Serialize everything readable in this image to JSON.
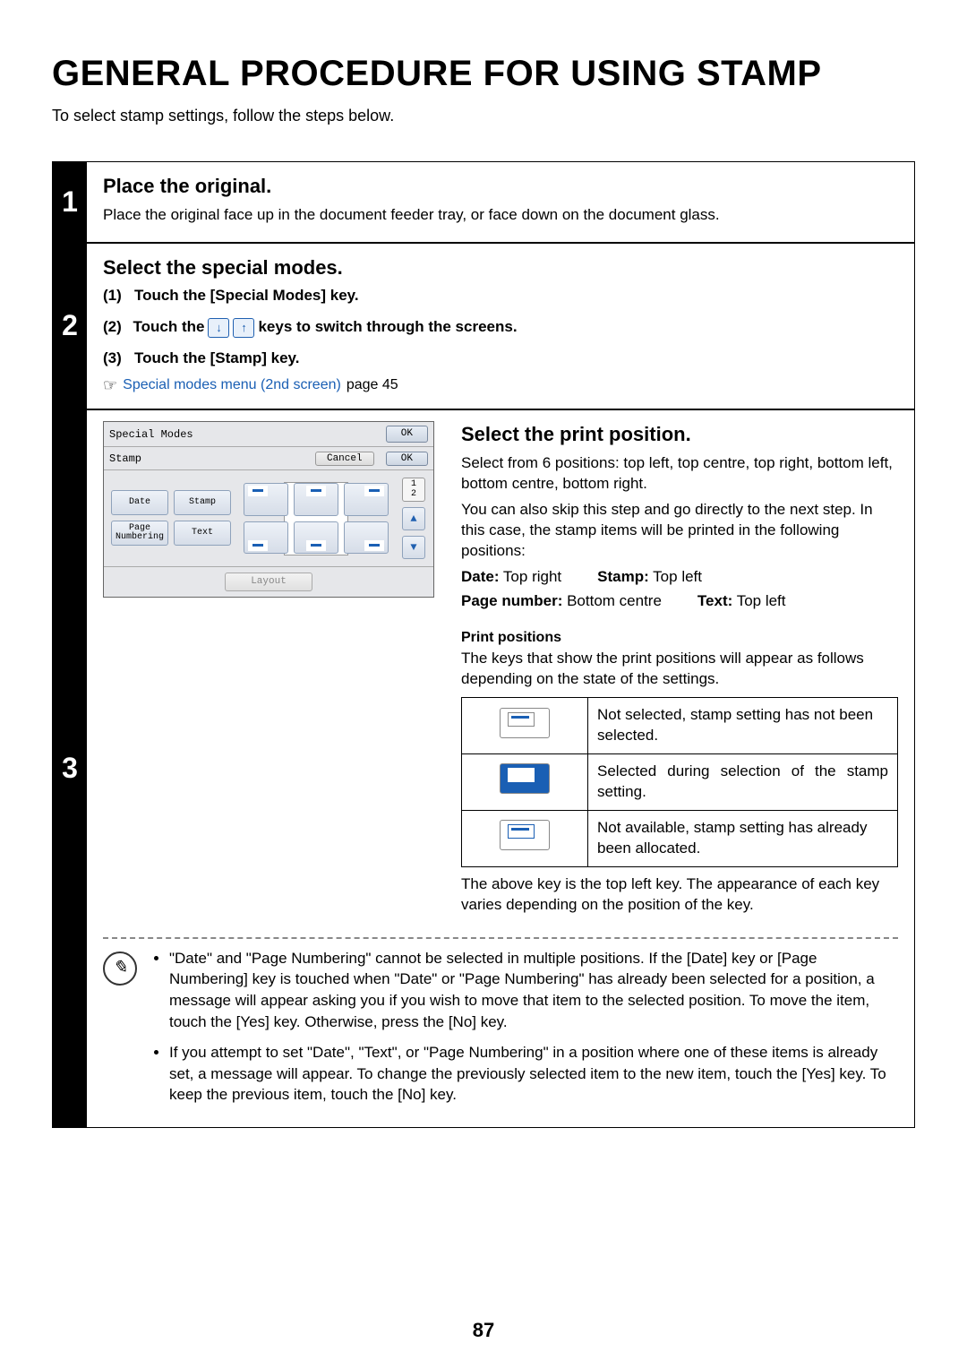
{
  "title": "GENERAL PROCEDURE FOR USING STAMP",
  "intro": "To select stamp settings, follow the steps below.",
  "page_number": "87",
  "step1": {
    "number": "1",
    "heading": "Place the original.",
    "body": "Place the original face up in the document feeder tray, or face down on the document glass."
  },
  "step2": {
    "number": "2",
    "heading": "Select the special modes.",
    "line1_label": "(1)",
    "line1": "Touch the [Special Modes] key.",
    "line2_label": "(2)",
    "line2_a": "Touch the",
    "line2_b": "keys to switch through the screens.",
    "line3_label": "(3)",
    "line3": "Touch the [Stamp] key.",
    "ref_link": "Special modes menu (2nd screen)",
    "ref_page": "page 45"
  },
  "step3": {
    "number": "3",
    "heading": "Select the print position.",
    "para1": "Select from 6 positions: top left, top centre, top right, bottom left, bottom centre, bottom right.",
    "para2": "You can also skip this step and go directly to the next step. In this case, the stamp items will be printed in the following positions:",
    "defaults": {
      "date_label": "Date:",
      "date_value": " Top right",
      "stamp_label": "Stamp:",
      "stamp_value": " Top left",
      "page_label": "Page number:",
      "page_value": " Bottom centre",
      "text_label": "Text:",
      "text_value": " Top left"
    },
    "sub_heading": "Print positions",
    "sub_desc": "The keys that show the print positions will appear as follows depending on the state of the settings.",
    "legend": {
      "row1": "Not selected, stamp setting has not been selected.",
      "row2": "Selected during selection of the stamp setting.",
      "row3": "Not available, stamp setting has already been allocated."
    },
    "after_table": "The above key is the top left key. The appearance of each key varies depending on the position of the key."
  },
  "notes": {
    "n1": "\"Date\" and \"Page Numbering\" cannot be selected in multiple positions. If the [Date] key or [Page Numbering] key is touched when \"Date\" or \"Page Numbering\" has already been selected for a position, a message will appear asking you if you wish to move that item to the selected position. To move the item, touch the [Yes] key. Otherwise, press the [No] key.",
    "n2": "If you attempt to set \"Date\", \"Text\", or \"Page Numbering\" in a position where one of these items is already set, a message will appear. To change the previously selected item to the new item, touch the [Yes] key. To keep the previous item, touch the [No] key."
  },
  "panel": {
    "title1": "Special Modes",
    "title2": "Stamp",
    "ok": "OK",
    "cancel": "Cancel",
    "buttons": {
      "date": "Date",
      "stamp": "Stamp",
      "page_numbering": "Page\nNumbering",
      "text": "Text"
    },
    "pager": {
      "current": "1",
      "total": "2"
    },
    "layout": "Layout"
  }
}
